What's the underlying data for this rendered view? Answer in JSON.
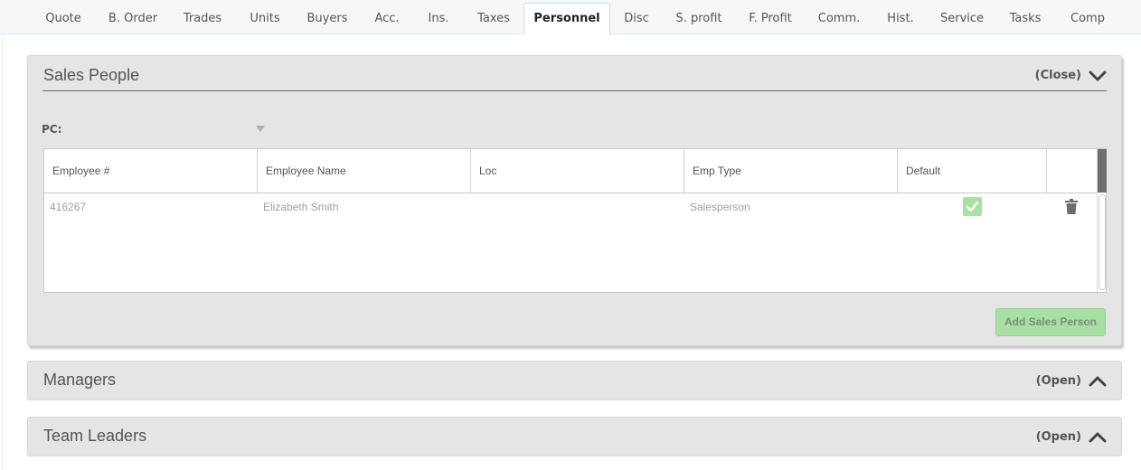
{
  "tabs": [
    {
      "label": "Quote"
    },
    {
      "label": "B. Order"
    },
    {
      "label": "Trades"
    },
    {
      "label": "Units"
    },
    {
      "label": "Buyers"
    },
    {
      "label": "Acc."
    },
    {
      "label": "Ins."
    },
    {
      "label": "Taxes"
    },
    {
      "label": "Personnel"
    },
    {
      "label": "Disc"
    },
    {
      "label": "S. profit"
    },
    {
      "label": "F. Profit"
    },
    {
      "label": "Comm."
    },
    {
      "label": "Hist."
    },
    {
      "label": "Service"
    },
    {
      "label": "Tasks"
    },
    {
      "label": "Comp"
    }
  ],
  "active_tab": "Personnel",
  "sales_people": {
    "title": "Sales People",
    "toggle_label": "(Close)",
    "pc_label": "PC:",
    "columns": [
      "Employee #",
      "Employee Name",
      "Loc",
      "Emp Type",
      "Default"
    ],
    "rows": [
      {
        "employee_no": "416267",
        "employee_name": "Elizabeth Smith",
        "loc": "",
        "emp_type": "Salesperson",
        "default": true
      }
    ],
    "add_button": "Add Sales Person"
  },
  "managers": {
    "title": "Managers",
    "toggle_label": "(Open)"
  },
  "team_leaders": {
    "title": "Team Leaders",
    "toggle_label": "(Open)"
  },
  "colors": {
    "accent_green": "#a8e0a5",
    "panel_bg": "#e5e5e5"
  },
  "icons": {
    "collapse": "chevron-down-icon",
    "expand": "chevron-up-icon",
    "delete": "trash-icon",
    "check": "check-icon",
    "dropdown": "caret-down-icon"
  }
}
